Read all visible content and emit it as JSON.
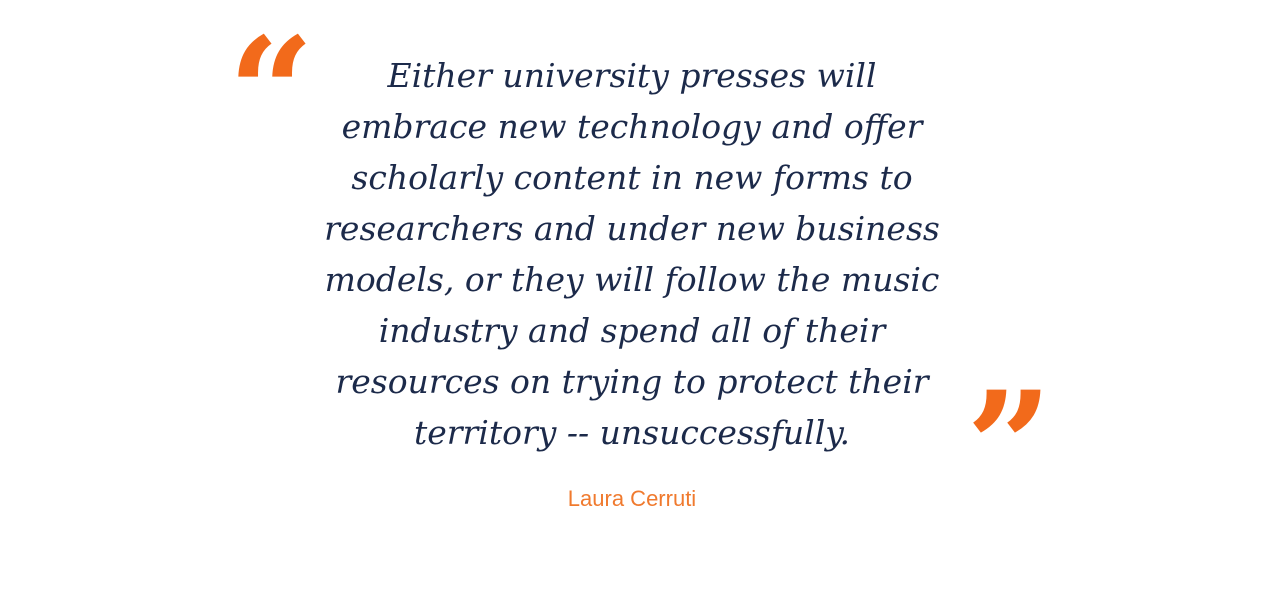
{
  "quote": {
    "text": "Either university presses will embrace new technology and offer scholarly content in new forms to researchers and under new business models, or they will follow the music industry and spend all of their resources on trying to protect their territory -- unsuccessfully.",
    "open_mark": "“",
    "close_mark": "”",
    "author": "Laura Cerruti"
  },
  "colors": {
    "accent": "#f26a1b",
    "text": "#1c2a4a",
    "author": "#f07a2e"
  }
}
